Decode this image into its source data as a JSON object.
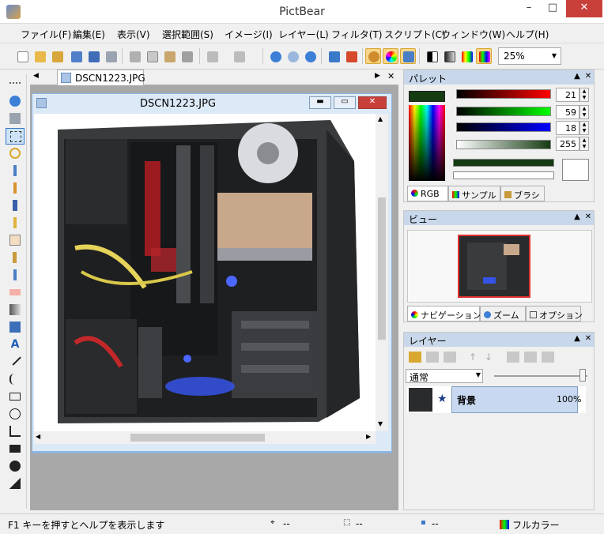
{
  "window": {
    "title": "PictBear",
    "minimize": "–",
    "maximize": "□",
    "close": "✕"
  },
  "menu": [
    "ファイル(F)",
    "編集(E)",
    "表示(V)",
    "選択範囲(S)",
    "イメージ(I)",
    "レイヤー(L)",
    "フィルタ(T)",
    "スクリプト(C)",
    "ウィンドウ(W)",
    "ヘルプ(H)"
  ],
  "toolbar": {
    "icons": [
      "new-icon",
      "open-icon",
      "open-folder-icon",
      "save-icon",
      "save-all-icon",
      "print-icon",
      "cut-icon",
      "copy-icon",
      "paste-icon",
      "crop-icon",
      "undo-icon",
      "redo-icon",
      "zoom-in-icon",
      "zoom-out-icon",
      "zoom-fit-icon",
      "image-icon",
      "image2-icon",
      "palette-icon",
      "color-wheel-icon",
      "layers-icon",
      "grayscale-icon",
      "gradient-icon",
      "rainbow-icon",
      "fullcolor-icon"
    ],
    "zoom_value": "25%"
  },
  "tools": [
    "select-dots-icon",
    "zoom-tool-icon",
    "move-icon",
    "rect-select-icon",
    "lasso-icon",
    "pen-icon",
    "brush-icon",
    "airbrush-icon",
    "pencil-icon",
    "hand-icon",
    "smudge-icon",
    "dropper-icon",
    "eraser-icon",
    "gradient-tool-icon",
    "fill-icon",
    "text-icon",
    "line-icon",
    "curve-icon",
    "rectangle-icon",
    "ellipse-icon",
    "polygon-icon",
    "filled-rect-icon",
    "filled-ellipse-icon",
    "filled-polygon-icon"
  ],
  "document": {
    "tab_label": "DSCN1223.JPG",
    "window_title": "DSCN1223.JPG"
  },
  "palette": {
    "title": "パレット",
    "r": "21",
    "g": "59",
    "b": "18",
    "a": "255",
    "current_color": "#153b12",
    "tabs": [
      "RGB",
      "サンプル",
      "ブラシ"
    ]
  },
  "view": {
    "title": "ビュー",
    "tabs": [
      "ナビゲーション",
      "ズーム",
      "オプション"
    ]
  },
  "layers": {
    "title": "レイヤー",
    "blend_mode": "通常",
    "items": [
      {
        "name": "背景",
        "opacity": "100%"
      }
    ]
  },
  "status": {
    "help": "F1 キーを押すとヘルプを表示します",
    "pos": "--",
    "size": "--",
    "color": "--",
    "mode": "フルカラー"
  }
}
